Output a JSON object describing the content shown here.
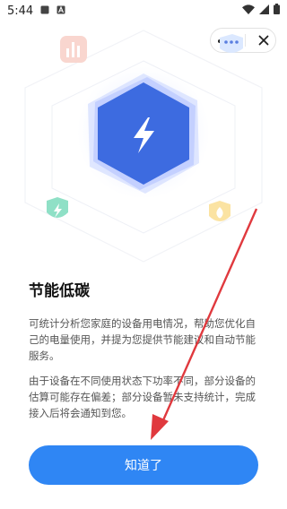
{
  "status_bar": {
    "time": "5:44",
    "icons": [
      "notification-square-icon",
      "letter-a-icon",
      "wifi-icon",
      "signal-icon",
      "battery-icon"
    ]
  },
  "top_actions": {
    "more_icon": "more-dots-icon",
    "close_icon": "close-icon"
  },
  "hero": {
    "center_icon": "lightning-icon",
    "badge_icons": [
      "chart-icon",
      "leaf-shield-icon",
      "flame-shield-icon",
      "dots-shield-icon"
    ],
    "accent_color": "#3d6be0"
  },
  "content": {
    "title": "节能低碳",
    "paragraph1": "可统计分析您家庭的设备用电情况，帮助您优化自己的电量使用，并提为您提供节能建议和自动节能服务。",
    "paragraph2": "由于设备在不同使用状态下功率不同，部分设备的估算可能存在偏差；部分设备暂未支持统计，完成接入后将会通知到您。"
  },
  "primary_button": {
    "label": "知道了",
    "color": "#2f86f4"
  },
  "annotation": {
    "arrow_color": "#e0393e"
  }
}
